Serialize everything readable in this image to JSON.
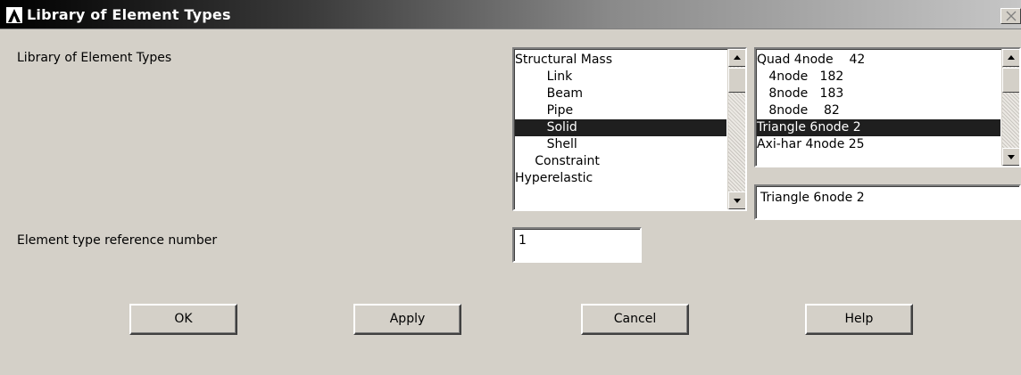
{
  "window": {
    "title": "Library of Element Types",
    "colors": {
      "titlebar_start": "#000000",
      "titlebar_end": "#c6c6c6",
      "face": "#d4d0c8",
      "selection": "#1f1f1f"
    }
  },
  "form": {
    "library_label": "Library of Element Types",
    "ref_label": "Element type reference number",
    "ref_value": "1"
  },
  "category_list": {
    "items": [
      "Structural Mass",
      "        Link",
      "        Beam",
      "        Pipe",
      "        Solid",
      "        Shell",
      "     Constraint",
      "Hyperelastic"
    ],
    "selected_index": 4
  },
  "element_list": {
    "items": [
      "Quad 4node    42",
      "   4node   182",
      "   8node   183",
      "   8node    82",
      "Triangle 6node 2",
      "Axi-har 4node 25"
    ],
    "selected_index": 4
  },
  "selection_field": {
    "value": "Triangle 6node 2"
  },
  "buttons": {
    "ok": "OK",
    "apply": "Apply",
    "cancel": "Cancel",
    "help": "Help"
  },
  "icons": {
    "logo": "ansys-logo-icon",
    "close": "close-icon",
    "scroll_up": "arrow-up-icon",
    "scroll_down": "arrow-down-icon"
  }
}
